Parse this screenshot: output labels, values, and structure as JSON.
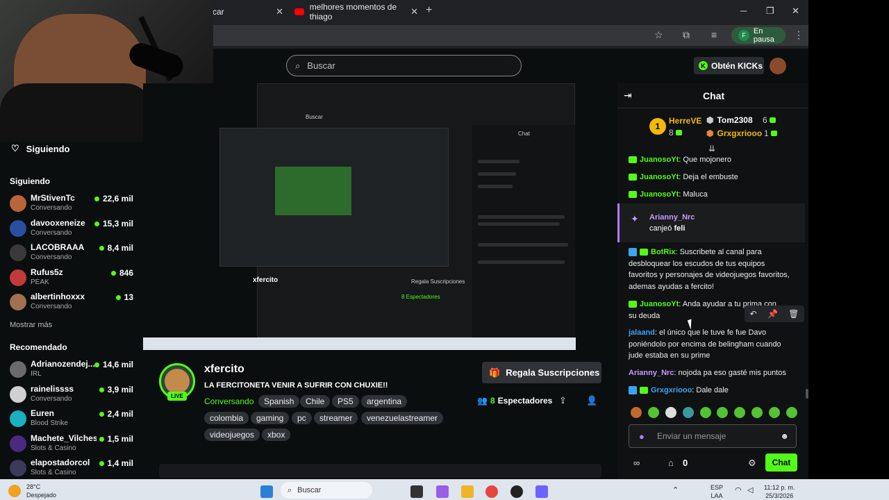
{
  "browser": {
    "tab1_title": "car",
    "tab2_title": "melhores momentos de thiago",
    "profile_label": "En pausa",
    "profile_initial": "F"
  },
  "header": {
    "search_placeholder": "Buscar",
    "kicks_button": "Obtén KICKs"
  },
  "sidebar": {
    "following_header": "Siguiendo",
    "following_section": "Siguiendo",
    "following": [
      {
        "name": "MrStivenTc",
        "sub": "Conversando",
        "viewers": "22,6 mil",
        "avatar_color": "#b8653a"
      },
      {
        "name": "davooxeneize",
        "sub": "Conversando",
        "viewers": "15,3 mil",
        "avatar_color": "#2a4fa0"
      },
      {
        "name": "LACOBRAAA",
        "sub": "Conversando",
        "viewers": "8,4 mil",
        "avatar_color": "#3a3a3a"
      },
      {
        "name": "Rufus5z",
        "sub": "PEAK",
        "viewers": "846",
        "avatar_color": "#c23a3a"
      },
      {
        "name": "albertinhoxxx",
        "sub": "Conversando",
        "viewers": "13",
        "avatar_color": "#a07050"
      }
    ],
    "show_more": "Mostrar más",
    "recommended_section": "Recomendado",
    "recommended": [
      {
        "name": "Adrianozendej...",
        "sub": "IRL",
        "viewers": "14,6 mil",
        "avatar_color": "#6a6a6a"
      },
      {
        "name": "rainelissss",
        "sub": "Conversando",
        "viewers": "3,9 mil",
        "avatar_color": "#d0d0d0"
      },
      {
        "name": "Euren",
        "sub": "Blood Strike",
        "viewers": "2,4 mil",
        "avatar_color": "#1ab0c0"
      },
      {
        "name": "Machete_Vilches",
        "sub": "Slots & Casino",
        "viewers": "1,5 mil",
        "avatar_color": "#4a2a80"
      },
      {
        "name": "elapostadorcol",
        "sub": "Slots & Casino",
        "viewers": "1,4 mil",
        "avatar_color": "#3a3a5a"
      }
    ]
  },
  "stream": {
    "channel": "xfercito",
    "live": "LIVE",
    "title": "LA FERCITONETA VENIR A SUFRIR CON CHUXIE!!",
    "category": "Conversando",
    "tags": [
      "Spanish",
      "Chile",
      "PS5",
      "argentina",
      "colombia",
      "gaming",
      "pc",
      "streamer",
      "venezuelastreamer",
      "videojuegos",
      "xbox"
    ],
    "gift_button": "Regala Suscripciones",
    "viewers": "8",
    "viewers_label": "Espectadores"
  },
  "player_preview": {
    "mini_search": "Buscar",
    "mini_chat": "Chat",
    "mini_channel": "xfercito",
    "mini_gift": "Regala Suscripciones",
    "mini_viewers": "8 Espectadores"
  },
  "chat": {
    "title": "Chat",
    "leaderboard": {
      "first_name": "HerreVE",
      "first_count": "8",
      "medal": "1",
      "second_name": "Tom2308",
      "second_count": "6",
      "third_name": "Grxgxriooo",
      "third_count": "1"
    },
    "messages": [
      {
        "user": "JuanosoYt",
        "text": ": Que mojonero",
        "color": "#53fc18"
      },
      {
        "user": "JuanosoYt",
        "text": ": Deja el embuste",
        "color": "#53fc18"
      },
      {
        "user": "JuanosoYt",
        "text": ": Maluca",
        "color": "#53fc18"
      }
    ],
    "sub_event": {
      "user": "Arianny_Nrc",
      "text": "canjeó",
      "bold": "feli"
    },
    "botrix": {
      "user": "BotRix",
      "text": ": Suscribete al canal para desbloquear los escudos de tus equipos favoritos y personajes de videojuegos favoritos, ademas ayudas a fercito!"
    },
    "msg_anda": {
      "user": "JuanosoYt",
      "text": ": Anda ayudar a tu prima con su deuda"
    },
    "msg_jalaand": {
      "user": "jalaand",
      "text": ": el único que le tuve fe fue Davo poniéndolo por encima de belingham cuando jude estaba en su prime"
    },
    "msg_arianny": {
      "user": "Arianny_Nrc",
      "text": ": nojoda pa eso gasté mis puntos"
    },
    "msg_grx": {
      "user": "Grxgxriooo",
      "text": ": Dale dale"
    },
    "input_placeholder": "Enviar un mensaje",
    "points": "0",
    "send_button": "Chat"
  },
  "taskbar": {
    "temp": "28°C",
    "weather": "Despejado",
    "search": "Buscar",
    "lang1": "ESP",
    "lang2": "LAA",
    "time": "11:12 p. m.",
    "date": "25/3/2026"
  }
}
